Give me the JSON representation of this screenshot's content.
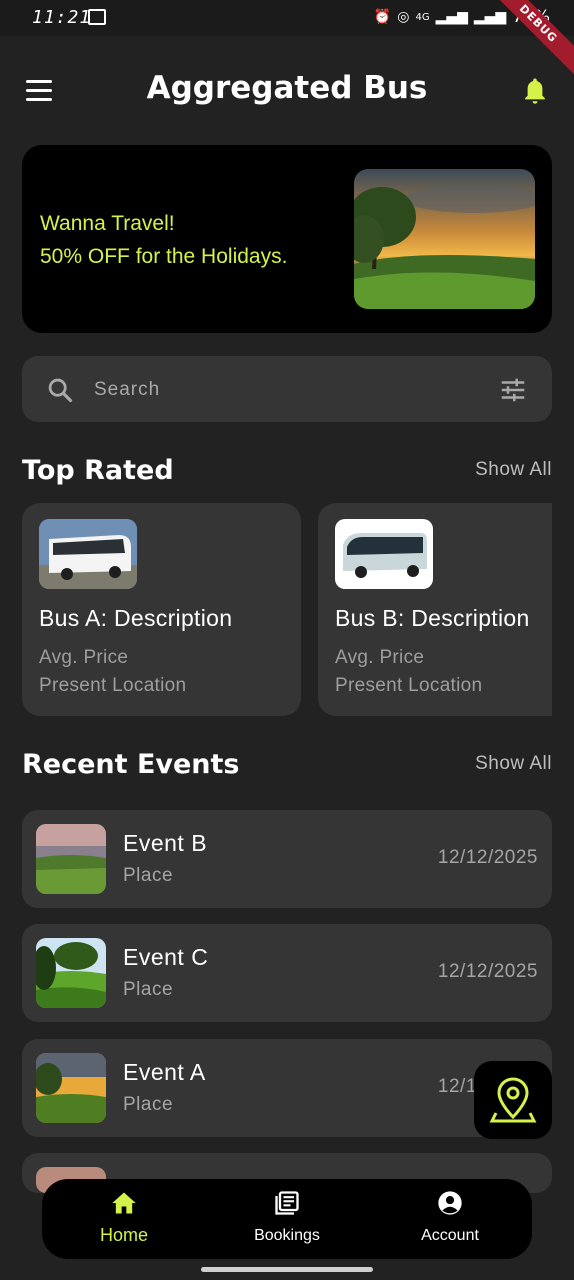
{
  "status_bar": {
    "time": "11:21",
    "network": "4G",
    "battery": "79%",
    "debug_label": "DEBUG"
  },
  "app_bar": {
    "title": "Aggregated Bus",
    "accent_color": "#d4f34a"
  },
  "banner": {
    "line1": "Wanna Travel!",
    "line2": "50% OFF for the Holidays."
  },
  "search": {
    "placeholder": "Search"
  },
  "top_rated": {
    "title": "Top Rated",
    "show_all": "Show All",
    "buses": [
      {
        "name": "Bus A: Description",
        "price_label": "Avg. Price",
        "location_label": "Present Location"
      },
      {
        "name": "Bus B: Description",
        "price_label": "Avg. Price",
        "location_label": "Present Location"
      }
    ]
  },
  "recent_events": {
    "title": "Recent Events",
    "show_all": "Show All",
    "events": [
      {
        "name": "Event B",
        "place": "Place",
        "date": "12/12/2025"
      },
      {
        "name": "Event C",
        "place": "Place",
        "date": "12/12/2025"
      },
      {
        "name": "Event A",
        "place": "Place",
        "date": "12/12/2025"
      }
    ]
  },
  "bottom_nav": {
    "items": [
      {
        "label": "Home",
        "icon": "home-icon",
        "active": true
      },
      {
        "label": "Bookings",
        "icon": "bookings-icon",
        "active": false
      },
      {
        "label": "Account",
        "icon": "account-icon",
        "active": false
      }
    ]
  }
}
